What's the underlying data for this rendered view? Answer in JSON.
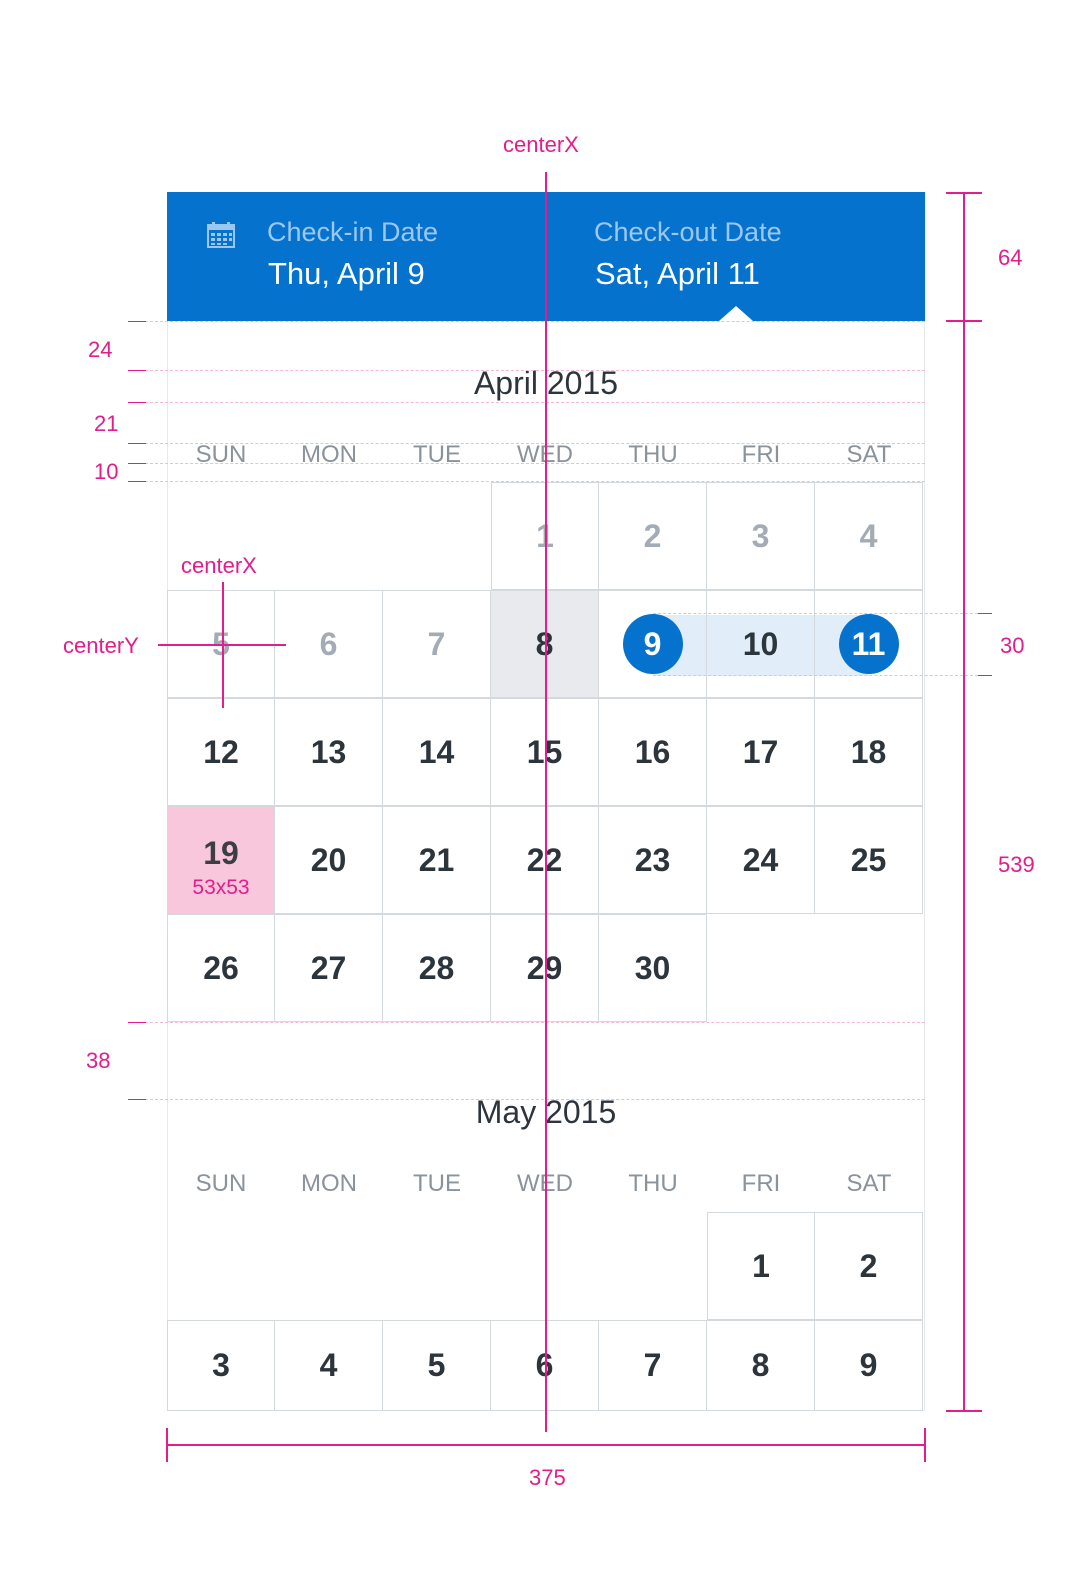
{
  "header": {
    "checkin_label": "Check-in Date",
    "checkin_value": "Thu, April 9",
    "checkout_label": "Check-out Date",
    "checkout_value": "Sat, April 11",
    "calendar_icon": "calendar-icon",
    "bg_color": "#0572ce"
  },
  "weekdays": [
    "SUN",
    "MON",
    "TUE",
    "WED",
    "THU",
    "FRI",
    "SAT"
  ],
  "months": [
    {
      "title": "April 2015",
      "days": [
        "1",
        "2",
        "3",
        "4",
        "5",
        "6",
        "7",
        "8",
        "9",
        "10",
        "11",
        "12",
        "13",
        "14",
        "15",
        "16",
        "17",
        "18",
        "19",
        "20",
        "21",
        "22",
        "23",
        "24",
        "25",
        "26",
        "27",
        "28",
        "29",
        "30"
      ],
      "today": "8",
      "checkin": "9",
      "checkout": "11",
      "highlight_day": "19",
      "highlight_label": "53x53"
    },
    {
      "title": "May 2015",
      "days": [
        "1",
        "2",
        "3",
        "4",
        "5",
        "6",
        "7",
        "8",
        "9"
      ]
    }
  ],
  "spec": {
    "centerx_top": "centerX",
    "centerx_cell": "centerX",
    "centery_cell": "centerY",
    "header_height": "64",
    "month_gap_top": "24",
    "title_gap": "21",
    "weekday_gap": "10",
    "circle_height": "30",
    "calendar_height": "539",
    "month_spacing": "38",
    "width": "375",
    "accent_color": "#e11e8c"
  }
}
